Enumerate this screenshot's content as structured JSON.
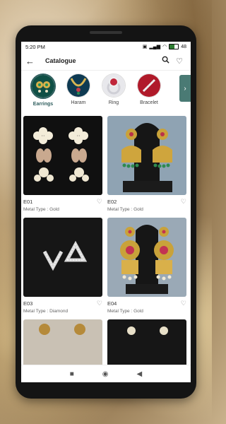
{
  "status": {
    "time": "5:20 PM",
    "battery": "48"
  },
  "header": {
    "title": "Catalogue"
  },
  "categories": [
    {
      "label": "Earrings"
    },
    {
      "label": "Haram"
    },
    {
      "label": "Ring"
    },
    {
      "label": "Bracelet"
    }
  ],
  "products": [
    {
      "code": "E01",
      "metal_type": "Metal Type :  Gold"
    },
    {
      "code": "E02",
      "metal_type": "Metal Type :  Gold"
    },
    {
      "code": "E03",
      "metal_type": "Metal Type :  Diamond"
    },
    {
      "code": "E04",
      "metal_type": "Metal Type :  Gold"
    }
  ],
  "colors": {
    "accent": "#2f5e5e",
    "next_button": "#4a7a74"
  }
}
